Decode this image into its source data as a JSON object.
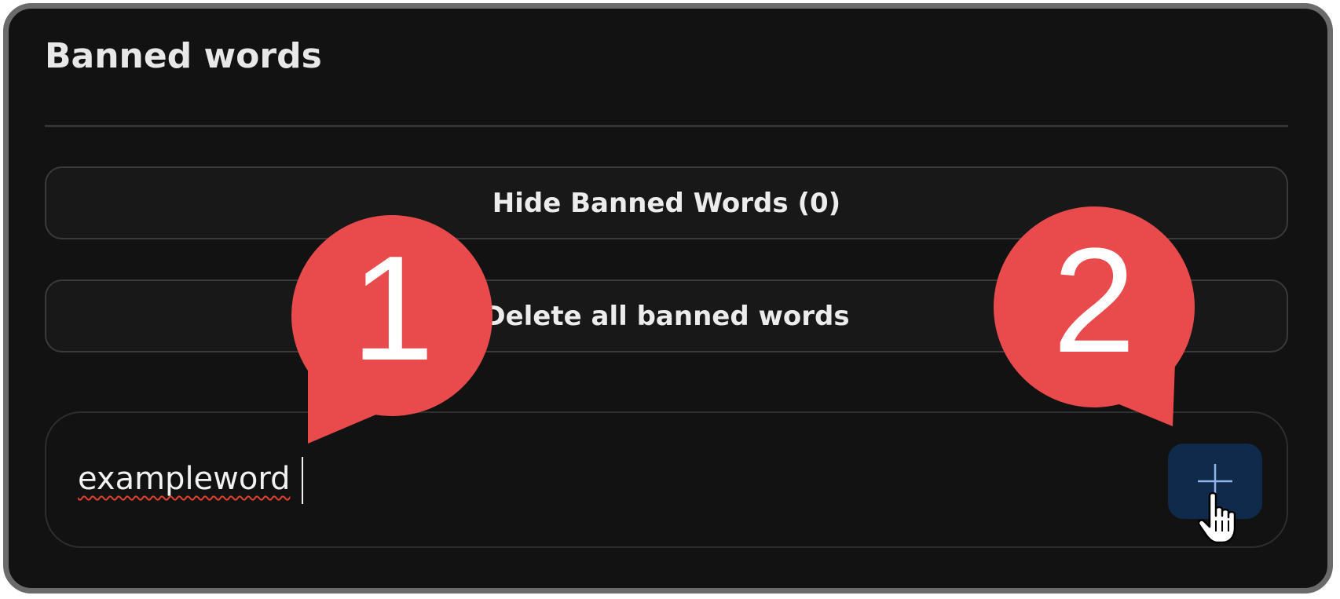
{
  "panel": {
    "title": "Banned words"
  },
  "buttons": {
    "hide_label": "Hide Banned Words (0)",
    "delete_label": "Delete all banned words",
    "add_icon": "plus-icon"
  },
  "input": {
    "value": "exampleword",
    "spellcheck_error": true
  },
  "callouts": [
    {
      "number": "1"
    },
    {
      "number": "2"
    }
  ],
  "colors": {
    "panel_bg": "#121212",
    "panel_border": "#6b6b6b",
    "button_bg": "#181818",
    "add_button_bg": "#102a4c",
    "plus_icon": "#8fb4ea",
    "callout": "#e94b4d",
    "spellcheck_underline": "#e0402f"
  }
}
